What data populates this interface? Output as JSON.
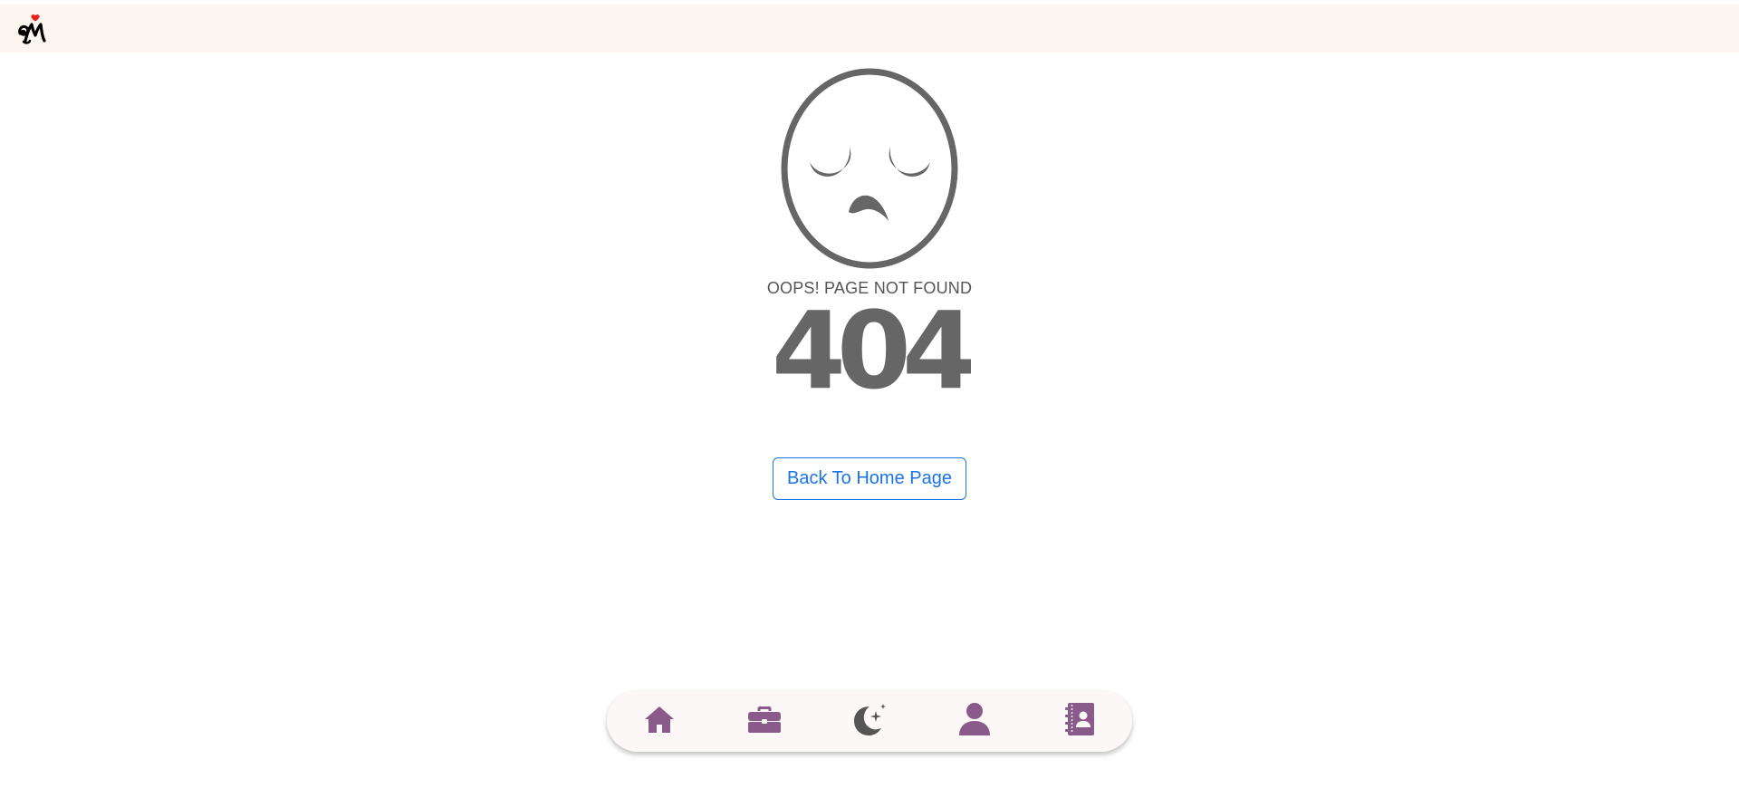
{
  "header": {
    "logo_icon": "heart-m-logo"
  },
  "error": {
    "face_icon": "sad-face-icon",
    "message": "OOPS! PAGE NOT FOUND",
    "code": "404",
    "back_button_label": "Back To Home Page"
  },
  "dock": {
    "items": [
      {
        "icon": "home-icon"
      },
      {
        "icon": "briefcase-icon"
      },
      {
        "icon": "moon-stars-icon"
      },
      {
        "icon": "user-icon"
      },
      {
        "icon": "contact-book-icon"
      }
    ]
  },
  "colors": {
    "topbar_bg": "#fdf6f0",
    "face_gray": "#666666",
    "link_blue": "#1a73e8",
    "dock_purple": "#8a5a8a",
    "theme_gray": "#555555",
    "logo_red": "#e8231e"
  }
}
